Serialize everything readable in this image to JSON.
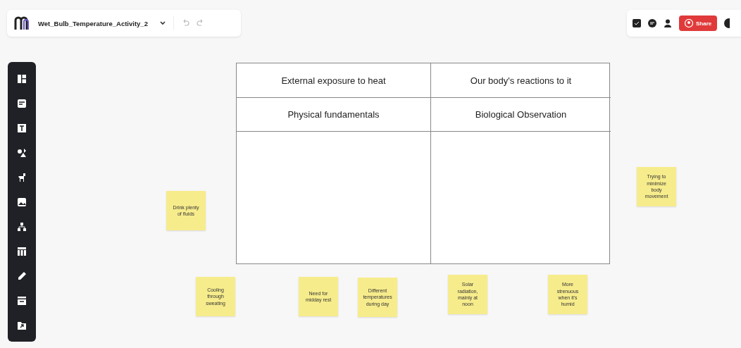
{
  "document": {
    "title": "Wet_Bulb_Temperature_Activity_2"
  },
  "header_actions": {
    "share_label": "Share"
  },
  "table": {
    "headers": [
      "External exposure to heat",
      "Our body's reactions to it"
    ],
    "subheaders": [
      "Physical fundamentals",
      "Biological Observation"
    ]
  },
  "sticky_notes": [
    {
      "text": "Drink plenty of fluids"
    },
    {
      "text": "Trying to minimize body movement"
    },
    {
      "text": "Cooling through sweating"
    },
    {
      "text": "Need for midday rest"
    },
    {
      "text": "Different temperatures during day"
    },
    {
      "text": "Solar radiation, mainly at noon"
    },
    {
      "text": "More strenuous when it's humid"
    }
  ]
}
